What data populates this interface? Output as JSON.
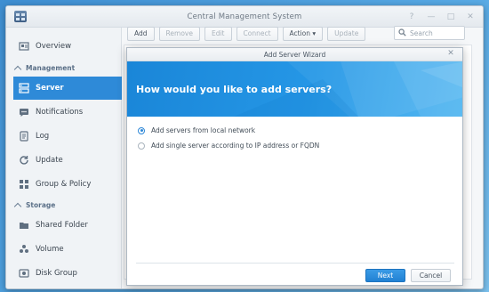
{
  "window": {
    "title": "Central Management System"
  },
  "sidebar": {
    "items": [
      {
        "label": "Overview",
        "icon": "overview-icon"
      },
      {
        "label": "Server",
        "icon": "server-icon",
        "active": true
      },
      {
        "label": "Notifications",
        "icon": "notifications-icon"
      },
      {
        "label": "Log",
        "icon": "log-icon"
      },
      {
        "label": "Update",
        "icon": "update-icon"
      },
      {
        "label": "Group & Policy",
        "icon": "group-policy-icon"
      },
      {
        "label": "Shared Folder",
        "icon": "shared-folder-icon"
      },
      {
        "label": "Volume",
        "icon": "volume-icon"
      },
      {
        "label": "Disk Group",
        "icon": "disk-group-icon"
      }
    ],
    "sections": {
      "management": "Management",
      "storage": "Storage"
    }
  },
  "toolbar": {
    "add": "Add",
    "remove": "Remove",
    "edit": "Edit",
    "connect": "Connect",
    "action": "Action ▾",
    "update": "Update"
  },
  "search": {
    "placeholder": "Search"
  },
  "dialog": {
    "title": "Add Server Wizard",
    "heading": "How would you like to add servers?",
    "options": [
      {
        "label": "Add servers from local network",
        "selected": true
      },
      {
        "label": "Add single server according to IP address or FQDN",
        "selected": false
      }
    ],
    "next_label": "Next",
    "cancel_label": "Cancel"
  },
  "colors": {
    "accent": "#2e8ad8",
    "banner": "#1a86d8"
  }
}
